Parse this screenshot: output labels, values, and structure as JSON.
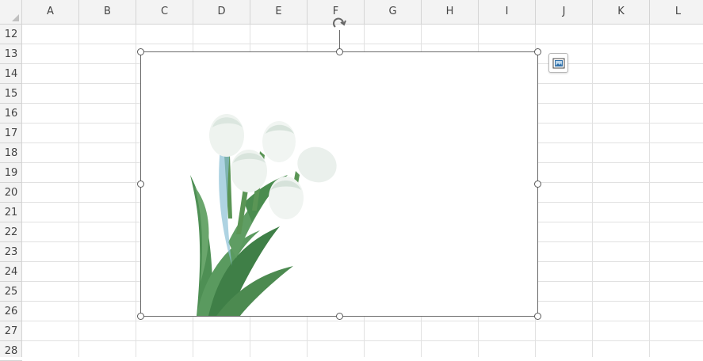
{
  "columns": [
    "A",
    "B",
    "C",
    "D",
    "E",
    "F",
    "G",
    "H",
    "I",
    "J",
    "K",
    "L"
  ],
  "rows": [
    "12",
    "13",
    "14",
    "15",
    "16",
    "17",
    "18",
    "19",
    "20",
    "21",
    "22",
    "23",
    "24",
    "25",
    "26",
    "27",
    "28"
  ],
  "picture": {
    "description_icon": "tulip-bouquet-image"
  },
  "icons": {
    "rotate": "rotate-handle-icon",
    "layout_options": "layout-options-icon"
  }
}
